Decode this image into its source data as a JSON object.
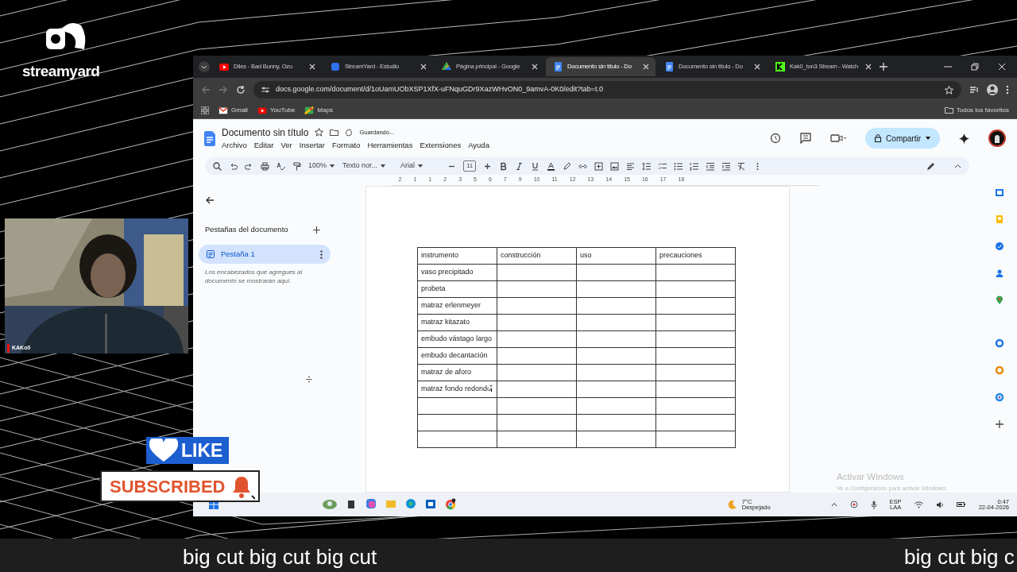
{
  "brand": {
    "name": "streamyard"
  },
  "camera": {
    "label": "KAKo0"
  },
  "browser": {
    "tabs": [
      {
        "title": "Diles - Bad Bunny, Ozu",
        "kind": "youtube",
        "selected": false
      },
      {
        "title": "StreamYard - Estudio",
        "kind": "streamyard",
        "selected": false
      },
      {
        "title": "Página principal - Google",
        "kind": "drive",
        "selected": false
      },
      {
        "title": "Documento sin título - Do",
        "kind": "docs",
        "selected": true
      },
      {
        "title": "Documento sin título - Do",
        "kind": "docs",
        "selected": false
      },
      {
        "title": "Kak0_ton3 Stream - Watch",
        "kind": "kick",
        "selected": false
      }
    ],
    "url": "docs.google.com/document/d/1oUamUObXSP1XfX-uFNquGDr9XazWHvON0_9amvA-0K0/edit?tab=t.0",
    "bookmarks": [
      {
        "label": "Gmail",
        "kind": "gmail"
      },
      {
        "label": "YouTube",
        "kind": "youtube"
      },
      {
        "label": "Maps",
        "kind": "maps"
      }
    ],
    "all_bookmarks": "Todos los favoritos"
  },
  "doc": {
    "title": "Documento sin título",
    "status": "Guardando...",
    "menu": [
      "Archivo",
      "Editar",
      "Ver",
      "Insertar",
      "Formato",
      "Herramientas",
      "Extensiones",
      "Ayuda"
    ],
    "share": "Compartir",
    "toolbar": {
      "zoom": "100%",
      "style": "Texto nor...",
      "font": "Arial",
      "size": "11"
    },
    "ruler": [
      "2",
      "1",
      "1",
      "2",
      "3",
      "5",
      "6",
      "7",
      "9",
      "10",
      "11",
      "12",
      "13",
      "14",
      "15",
      "16",
      "17",
      "18"
    ],
    "sidebar": {
      "heading": "Pestañas del documento",
      "tabs": [
        {
          "label": "Pestaña 1",
          "selected": true
        }
      ],
      "hint": "Los encabezados que agregues al documento se mostrarán aquí."
    },
    "table": {
      "columns": [
        "instrumento",
        "construcción",
        "uso",
        "precauciones"
      ],
      "rows": [
        "vaso precipitado",
        "probeta",
        "matraz erlenmeyer",
        "matraz kitazato",
        "embudo vástago largo",
        "embudo decantación",
        "matraz de aforo",
        "matraz fondo redondo"
      ]
    }
  },
  "taskbar": {
    "temp": "7°C",
    "weather": "Despejado",
    "lang": "ESP",
    "region": "LAA",
    "time": "0:47",
    "date": "22-04-2026"
  },
  "activation": {
    "title": "Activar Windows",
    "text": "Ve a Configuración para activar Windows."
  },
  "overlays": {
    "like": "LIKE",
    "subscribe": "SUBSCRIBED",
    "ticker": [
      "big cut big cut big cut",
      "big cut big c"
    ]
  }
}
